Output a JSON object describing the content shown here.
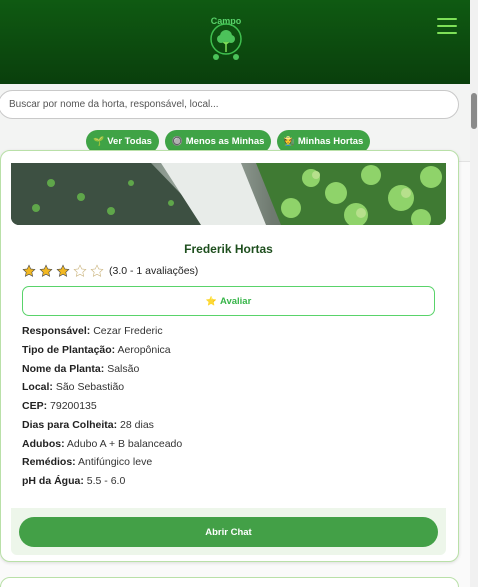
{
  "header": {
    "logo_text": "Campo",
    "menu_icon": "hamburger-menu-icon",
    "colors": {
      "header_bg": "#0a3f0c",
      "accent": "#7ee058"
    }
  },
  "search": {
    "placeholder": "Buscar por nome da horta, responsável, local...",
    "value": ""
  },
  "filters": [
    {
      "icon": "🌱",
      "label": "Ver Todas"
    },
    {
      "icon": "🔘",
      "label": "Menos as Minhas"
    },
    {
      "icon": "🧑‍🌾",
      "label": "Minhas Hortas"
    }
  ],
  "card": {
    "title": "Frederik Hortas",
    "rating": {
      "value": 3,
      "max": 5,
      "text": "(3.0 - 1 avaliações)"
    },
    "rate_button": {
      "icon": "⭐",
      "label": "Avaliar"
    },
    "details": [
      {
        "key": "Responsável:",
        "value": "Cezar Frederic"
      },
      {
        "key": "Tipo de Plantação:",
        "value": "Aeropônica"
      },
      {
        "key": "Nome da Planta:",
        "value": "Salsão"
      },
      {
        "key": "Local:",
        "value": "São Sebastião"
      },
      {
        "key": "CEP:",
        "value": "79200135"
      },
      {
        "key": "Dias para Colheita:",
        "value": "28 dias"
      },
      {
        "key": "Adubos:",
        "value": "Adubo A + B balanceado"
      },
      {
        "key": "Remédios:",
        "value": "Antifúngico leve"
      },
      {
        "key": "pH da Água:",
        "value": "5.5 - 6.0"
      }
    ],
    "chat_button": "Abrir Chat"
  },
  "colors": {
    "primary": "#43a047",
    "title": "#1e4f1e",
    "star": "#f2b822"
  }
}
